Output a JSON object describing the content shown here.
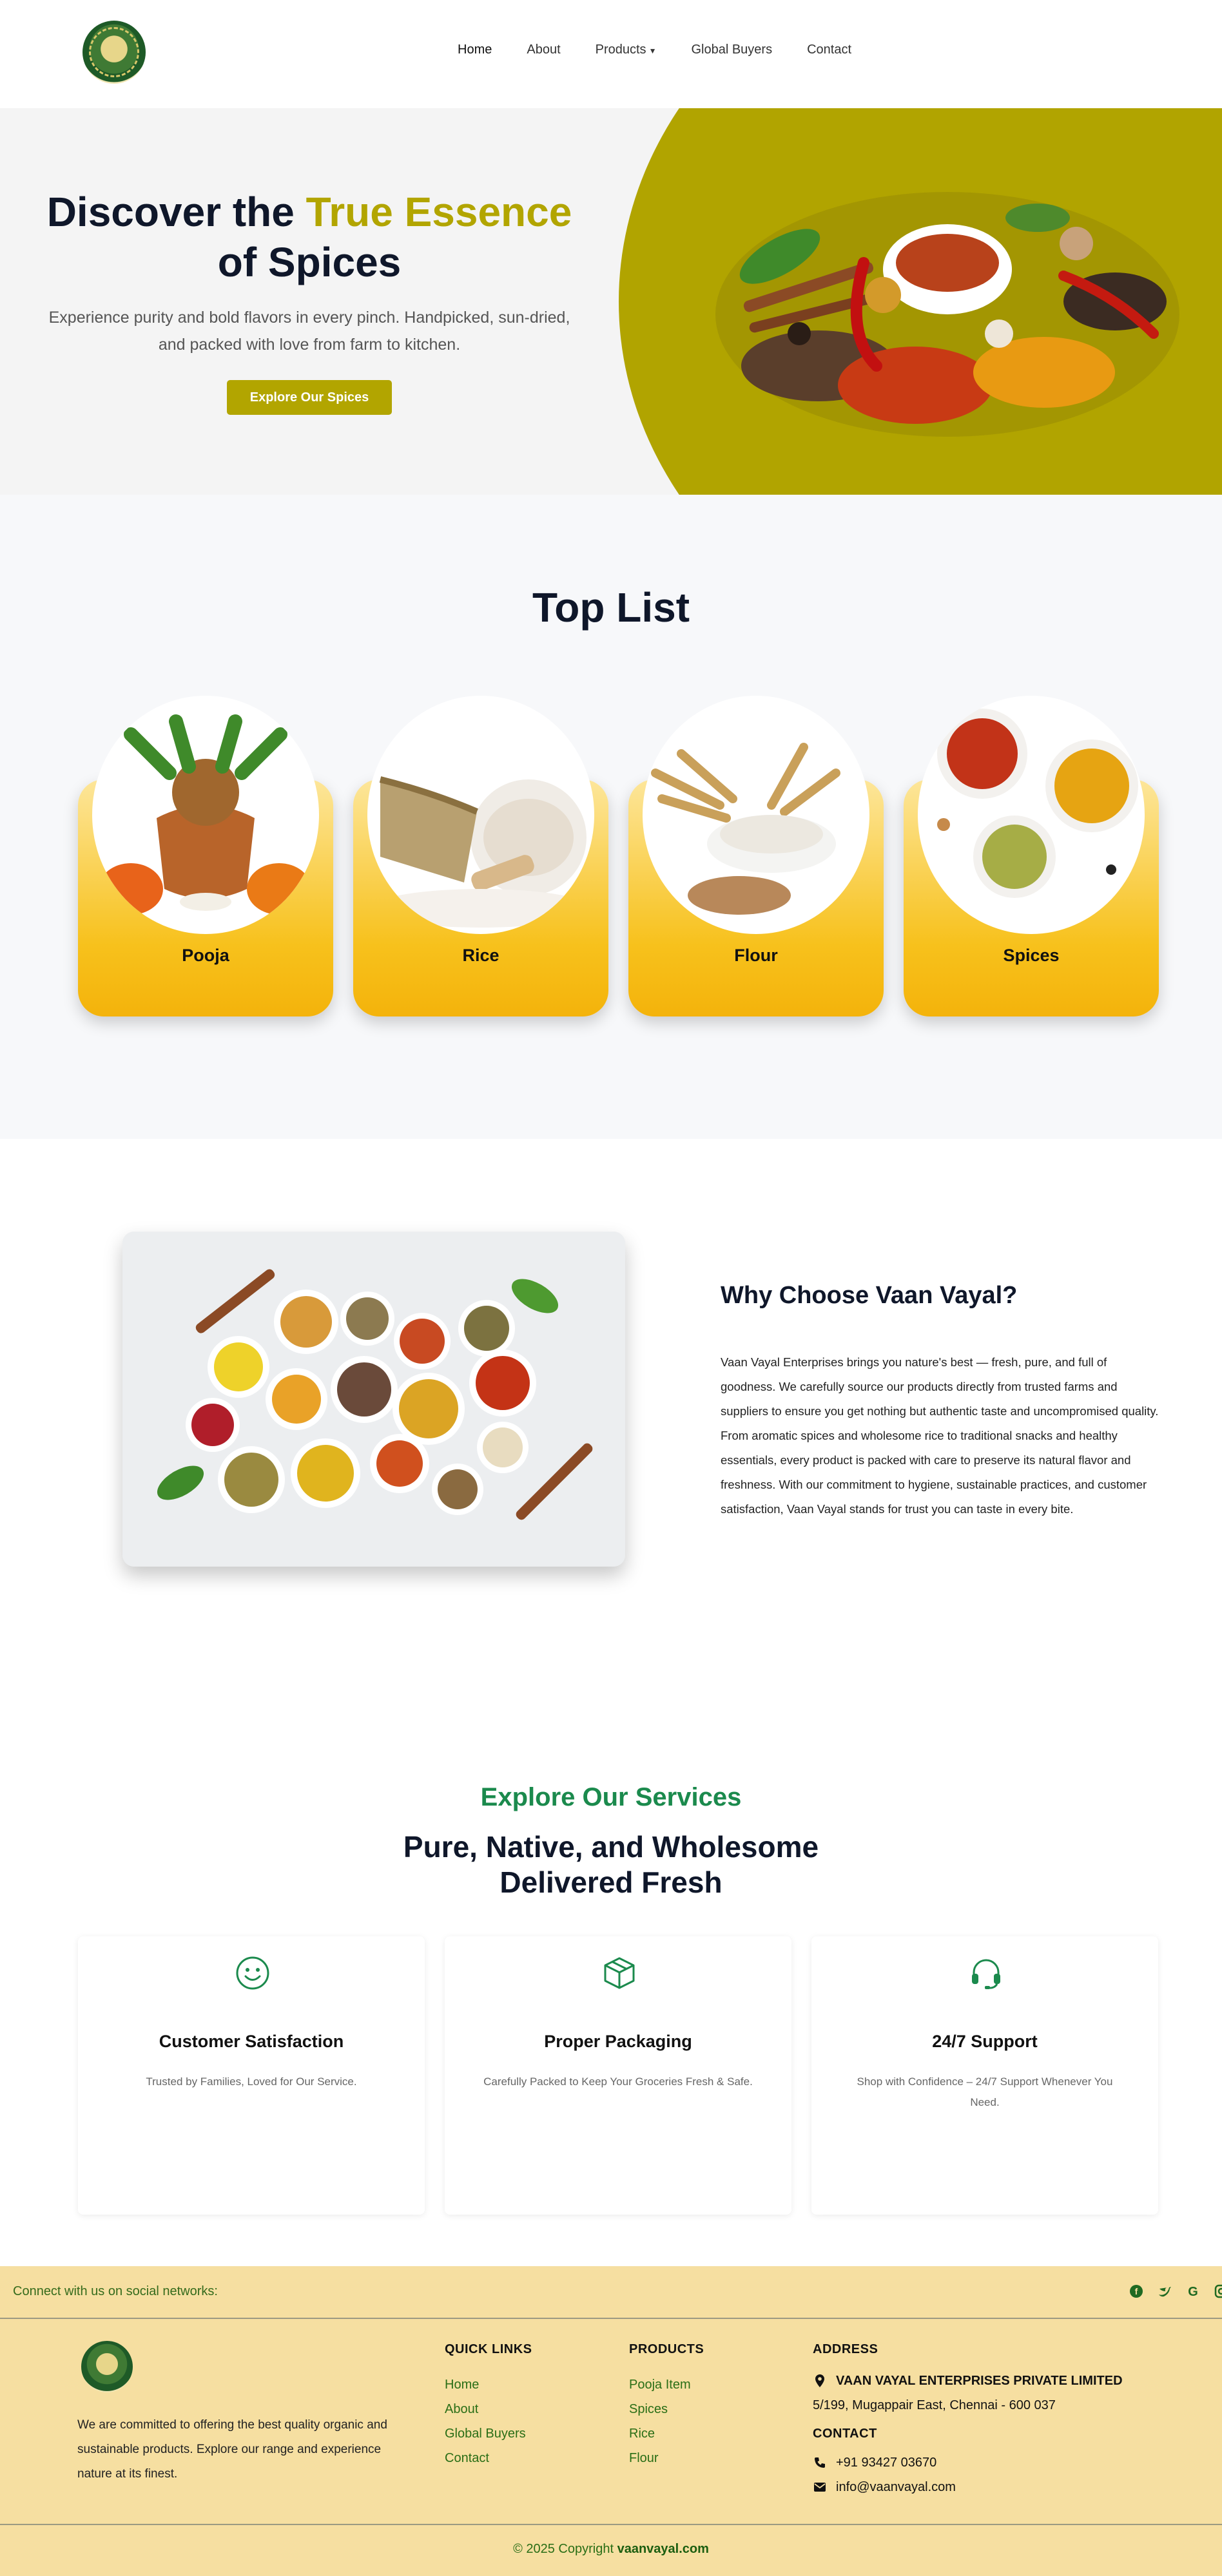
{
  "nav": {
    "items": [
      {
        "label": "Home"
      },
      {
        "label": "About"
      },
      {
        "label": "Products"
      },
      {
        "label": "Global Buyers"
      },
      {
        "label": "Contact"
      }
    ]
  },
  "hero": {
    "title_part1": "Discover the ",
    "title_accent": "True Essence",
    "title_part2": "of Spices",
    "subtitle": "Experience purity and bold flavors in every pinch. Handpicked, sun-dried, and packed with love from farm to kitchen.",
    "button": "Explore Our Spices"
  },
  "toplist": {
    "title": "Top List",
    "cards": [
      {
        "label": "Pooja"
      },
      {
        "label": "Rice"
      },
      {
        "label": "Flour"
      },
      {
        "label": "Spices"
      }
    ]
  },
  "why": {
    "title": "Why Choose Vaan Vayal?",
    "text": "Vaan Vayal Enterprises brings you nature's best — fresh, pure, and full of goodness. We carefully source our products directly from trusted farms and suppliers to ensure you get nothing but authentic taste and uncompromised quality. From aromatic spices and wholesome rice to traditional snacks and healthy essentials, every product is packed with care to preserve its natural flavor and freshness. With our commitment to hygiene, sustainable practices, and customer satisfaction, Vaan Vayal stands for trust you can taste in every bite."
  },
  "services": {
    "kicker": "Explore Our Services",
    "title": "Pure, Native, and Wholesome Delivered Fresh",
    "cards": [
      {
        "name": "Customer Satisfaction",
        "desc": "Trusted by Families, Loved for Our Service.",
        "icon": "smile-icon"
      },
      {
        "name": "Proper Packaging",
        "desc": "Carefully Packed to Keep Your Groceries Fresh & Safe.",
        "icon": "box-icon"
      },
      {
        "name": "24/7 Support",
        "desc": "Shop with Confidence – 24/7 Support Whenever You Need.",
        "icon": "headset-icon"
      }
    ]
  },
  "social": {
    "text": "Connect with us on social networks:",
    "icons": [
      "facebook-icon",
      "twitter-icon",
      "google-icon",
      "instagram-icon"
    ]
  },
  "footer": {
    "about": "We are committed to offering the best quality organic and sustainable products. Explore our range and experience nature at its finest.",
    "quick_links_head": "QUICK LINKS",
    "quick_links": [
      "Home",
      "About",
      "Global Buyers",
      "Contact"
    ],
    "products_head": "PRODUCTS",
    "products": [
      "Pooja Item",
      "Spices",
      "Rice",
      "Flour"
    ],
    "address_head": "ADDRESS",
    "company": "VAAN VAYAL ENTERPRISES PRIVATE LIMITED",
    "address": "5/199, Mugappair East, Chennai - 600 037",
    "contact_head": "CONTACT",
    "phone": "+91 93427 03670",
    "email": "info@vaanvayal.com"
  },
  "copyright": {
    "prefix": "© 2025 Copyright ",
    "site": "vaanvayal.com"
  },
  "colors": {
    "olive": "#b1a400",
    "green": "#1b8a4d",
    "footer_bg": "#f6dfa1",
    "card_gold": "#f7c11c"
  }
}
